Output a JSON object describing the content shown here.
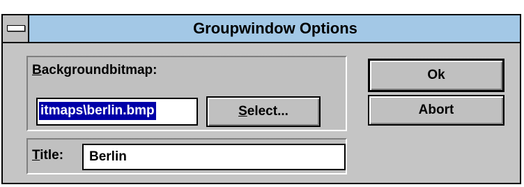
{
  "window": {
    "title": "Groupwindow Options"
  },
  "background": {
    "label_first": "B",
    "label_rest": "ackgroundbitmap:",
    "value": "itmaps\\berlin.bmp",
    "select_first": "S",
    "select_rest": "elect..."
  },
  "title_field": {
    "label_first": "T",
    "label_rest": "itle:",
    "value": "Berlin"
  },
  "buttons": {
    "ok": "Ok",
    "abort": "Abort"
  },
  "colors": {
    "titlebar": "#a3c8e6",
    "selection": "#0000a8",
    "face": "#c0c0c0"
  }
}
